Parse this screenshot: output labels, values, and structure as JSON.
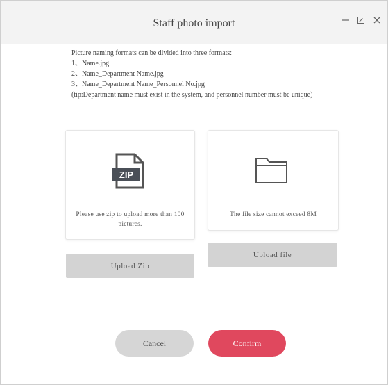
{
  "window": {
    "title": "Staff photo import",
    "controls": {
      "minimize": "minimize-icon",
      "maximize": "maximize-icon",
      "close": "close-icon"
    }
  },
  "naming_rules": {
    "intro": "Picture naming formats can be divided into three formats:",
    "formats": [
      "1、Name.jpg",
      "2、Name_Department Name.jpg",
      "3、Name_Department Name_Personnel No.jpg"
    ],
    "tip": "(tip:Department name must exist in the system, and personnel number must be unique)"
  },
  "zip_card": {
    "icon": "zip-file-icon",
    "badge": "ZIP",
    "hint": "Please use zip to upload more than 100 pictures.",
    "button_label": "Upload Zip"
  },
  "file_card": {
    "icon": "folder-icon",
    "hint": "The file size cannot exceed 8M",
    "button_label": "Upload file"
  },
  "footer": {
    "cancel_label": "Cancel",
    "confirm_label": "Confirm"
  },
  "colors": {
    "confirm": "#e0485e",
    "secondary_button": "#d3d3d3",
    "title_bar": "#f3f3f3"
  }
}
